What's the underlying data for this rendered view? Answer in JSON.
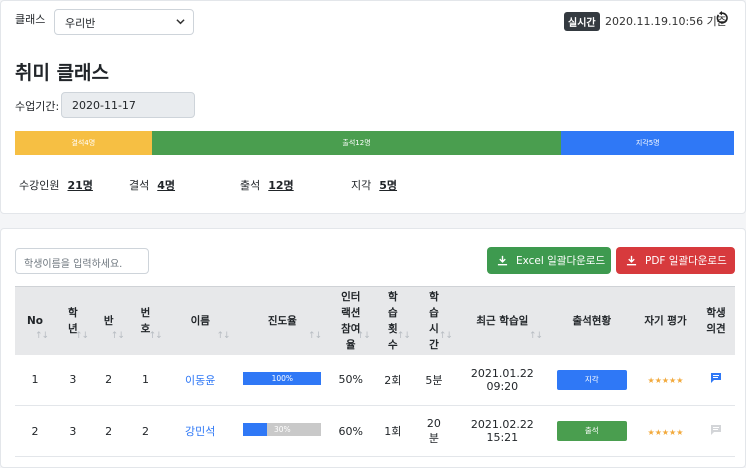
{
  "filter": {
    "class_label": "클래스",
    "class_value": "우리반"
  },
  "realtime": {
    "badge": "실시간",
    "timestamp": "2020.11.19.10:56 기준"
  },
  "title": "취미 클래스",
  "period": {
    "label": "수업기간:",
    "value": "2020-11-17"
  },
  "attendance_bar": {
    "segments": [
      {
        "label": "결석4명",
        "fraction": 0.19,
        "color": "#f6bf43"
      },
      {
        "label": "출석12명",
        "fraction": 0.57,
        "color": "#4a9e4f"
      },
      {
        "label": "지각5명",
        "fraction": 0.24,
        "color": "#2f78f6"
      }
    ]
  },
  "stats": [
    {
      "label": "수강인원",
      "value": "21명"
    },
    {
      "label": "결석",
      "value": "4명"
    },
    {
      "label": "출석",
      "value": "12명"
    },
    {
      "label": "지각",
      "value": "5명"
    }
  ],
  "search": {
    "placeholder": "학생이름을 입력하세요."
  },
  "buttons": {
    "excel": "Excel 일괄다운로드",
    "pdf": "PDF 일괄다운로드"
  },
  "table": {
    "headers": {
      "no": "No",
      "grade": "학년",
      "class": "반",
      "number": "번호",
      "name": "이름",
      "progress": "진도율",
      "interaction": "인터랙션참여율",
      "count": "학습횟수",
      "time": "학습시간",
      "recent": "최근 학습일",
      "status": "출석현황",
      "self": "자기 평가",
      "opinion": "학생의견"
    },
    "rows": [
      {
        "no": "1",
        "grade": "3",
        "class": "2",
        "number": "1",
        "name": "이동윤",
        "progress_label": "100%",
        "progress": 1.0,
        "interaction": "50%",
        "count": "2회",
        "time": "5분",
        "date": "2021.01.22",
        "clock": "09:20",
        "status": "지각",
        "stars": "★★★★★"
      },
      {
        "no": "2",
        "grade": "3",
        "class": "2",
        "number": "2",
        "name": "강민석",
        "progress_label": "30%",
        "progress": 0.3,
        "interaction": "60%",
        "count": "1회",
        "time": "20분",
        "date": "2021.02.22",
        "clock": "15:21",
        "status": "출석",
        "stars": "★★★★★"
      }
    ]
  }
}
